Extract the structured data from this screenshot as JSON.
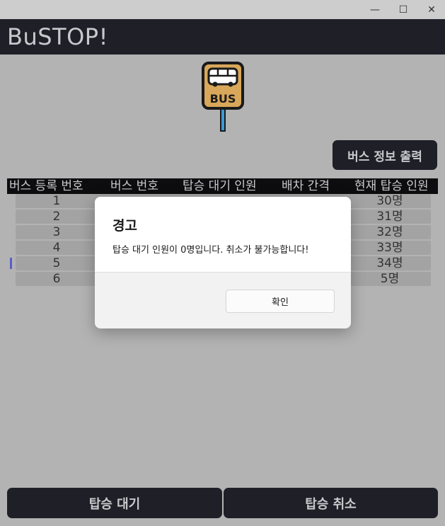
{
  "window": {
    "controls": {
      "minimize": "—",
      "maximize": "☐",
      "close": "✕"
    }
  },
  "app": {
    "title": "BuSTOP!"
  },
  "logo": {
    "icon": "bus-stop-sign-icon",
    "text": "BUS"
  },
  "actions": {
    "print_info": "버스 정보 출력",
    "board_wait": "탑승 대기",
    "board_cancel": "탑승 취소"
  },
  "table": {
    "columns": [
      "버스 등록 번호",
      "버스 번호",
      "탑승 대기 인원",
      "배차 간격",
      "현재 탑승 인원"
    ],
    "rows": [
      {
        "reg": "1",
        "current": "30명"
      },
      {
        "reg": "2",
        "current": "31명"
      },
      {
        "reg": "3",
        "current": "32명"
      },
      {
        "reg": "4",
        "current": "33명"
      },
      {
        "reg": "5",
        "current": "34명"
      },
      {
        "reg": "6",
        "current": "5명"
      }
    ]
  },
  "dialog": {
    "title": "경고",
    "message": "탑승 대기 인원이 0명입니다. 취소가 불가능합니다!",
    "ok": "확인"
  },
  "colors": {
    "background": "#b3b3b3",
    "dark": "#1f1f28",
    "header": "#0d0d10",
    "row": "#a3a3a3",
    "logo_fill": "#d9a75a",
    "logo_pole": "#3a9bd9"
  }
}
